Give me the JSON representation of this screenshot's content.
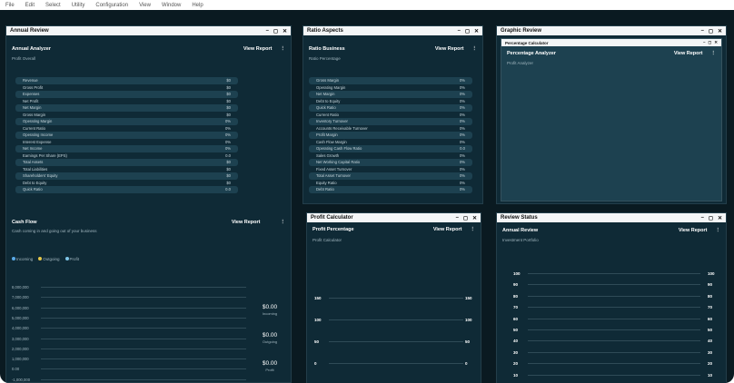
{
  "menu": [
    "File",
    "Edit",
    "Select",
    "Utility",
    "Configuration",
    "View",
    "Window",
    "Help"
  ],
  "annual": {
    "win_title": "Annual Review",
    "analyzer_title": "Annual Analyzer",
    "view_report": "View Report",
    "subtitle": "Profit Overall",
    "rows": [
      [
        "Revenue",
        "$0"
      ],
      [
        "Gross Profit",
        "$0"
      ],
      [
        "Expenses",
        "$0"
      ],
      [
        "Net Profit",
        "$0"
      ],
      [
        "Net Margin",
        "$0"
      ],
      [
        "Gross Margin",
        "$0"
      ],
      [
        "Operating Margin",
        "0%"
      ],
      [
        "Current Ratio",
        "0%"
      ],
      [
        "Operating Income",
        "0%"
      ],
      [
        "Interest Expense",
        "0%"
      ],
      [
        "Net Income",
        "0%"
      ],
      [
        "Earnings Per Share (EPS)",
        "0.0"
      ],
      [
        "Total Assets",
        "$0"
      ],
      [
        "Total Liabilities",
        "$0"
      ],
      [
        "Shareholders' Equity",
        "$0"
      ],
      [
        "Debt to Equity",
        "$0"
      ],
      [
        "Quick Ratio",
        "0.0"
      ]
    ],
    "cash_title": "Cash Flow",
    "cash_view": "View Report",
    "cash_sub": "Cash coming in and going out of your business",
    "legend": [
      {
        "name": "Incoming",
        "color": "#5aa9e6"
      },
      {
        "name": "Outgoing",
        "color": "#e6c84a"
      },
      {
        "name": "Profit",
        "color": "#7ec6e8"
      }
    ],
    "yticks": [
      "8,000,000",
      "7,000,000",
      "6,000,000",
      "5,000,000",
      "4,000,000",
      "3,000,000",
      "2,000,000",
      "1,000,000",
      "0.00",
      "-1,000,000",
      "-2,000,000"
    ],
    "values": [
      {
        "amount": "$0.00",
        "label": "Incoming"
      },
      {
        "amount": "$0.00",
        "label": "Outgoing"
      },
      {
        "amount": "$0.00",
        "label": "Profit"
      }
    ]
  },
  "ratio": {
    "win_title": "Ratio Aspects",
    "business_title": "Ratio Business",
    "view_report": "View Report",
    "subtitle": "Ratio Percentage",
    "rows": [
      [
        "Gross Margin",
        "0%"
      ],
      [
        "Operating Margin",
        "0%"
      ],
      [
        "Net Margin",
        "0%"
      ],
      [
        "Debt to Equity",
        "0%"
      ],
      [
        "Quick Ratio",
        "0%"
      ],
      [
        "Current Ratio",
        "0%"
      ],
      [
        "Inventory Turnover",
        "0%"
      ],
      [
        "Accounts Receivable Turnover",
        "0%"
      ],
      [
        "Profit Margin",
        "0%"
      ],
      [
        "Cash Flow Margin",
        "0%"
      ],
      [
        "Operating Cash Flow Ratio",
        "0.0"
      ],
      [
        "Sales Growth",
        "0%"
      ],
      [
        "Net Working Capital Ratio",
        "0%"
      ],
      [
        "Fixed Asset Turnover",
        "0%"
      ],
      [
        "Total Asset Turnover",
        "0%"
      ],
      [
        "Equity Ratio",
        "0%"
      ],
      [
        "Debt Ratio",
        "0%"
      ]
    ]
  },
  "profit": {
    "win_title": "Profit Calculator",
    "section_title": "Profit Percentage",
    "view_report": "View Report",
    "subtitle": "Profit Calculator",
    "ticks": [
      "150",
      "100",
      "50",
      "0",
      "-50"
    ]
  },
  "graphic": {
    "win_title": "Graphic Review",
    "inner_title": "Percentage Calculator",
    "section_title": "Percentage Analyzer",
    "view_report": "View Report",
    "subtitle": "Profit Analyzer"
  },
  "review": {
    "win_title": "Review Status",
    "section_title": "Annual Review",
    "view_report": "View Report",
    "subtitle": "Investment Portfolio",
    "ticks": [
      "100",
      "90",
      "80",
      "70",
      "60",
      "50",
      "40",
      "30",
      "20",
      "10",
      "0"
    ]
  },
  "controls": {
    "min": "–",
    "max": "◻",
    "close": "✕",
    "kebab": "⋮"
  }
}
